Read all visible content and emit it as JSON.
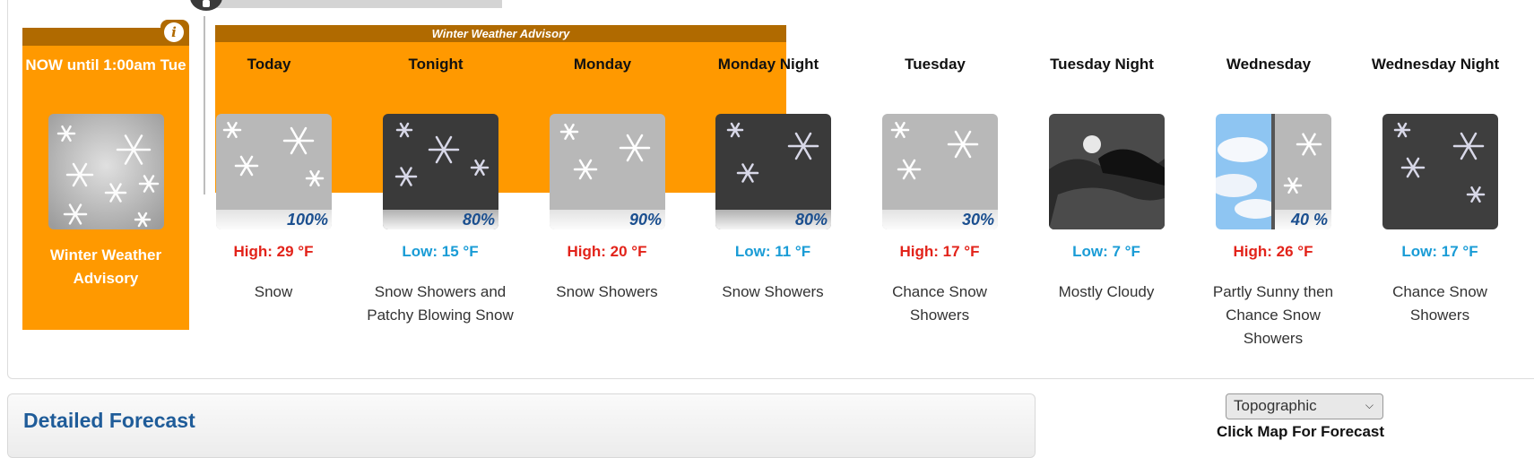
{
  "advisory": {
    "banner": "Winter Weather Advisory"
  },
  "now": {
    "title": "NOW until 1:00am Tue",
    "label": "Winter Weather Advisory",
    "icon": "snow-icon",
    "info_icon": "info-icon"
  },
  "periods": [
    {
      "name": "Today",
      "temp": "High: 29 °F",
      "kind": "high",
      "desc": "Snow",
      "pop": "100%",
      "icon": "snow"
    },
    {
      "name": "Tonight",
      "temp": "Low: 15 °F",
      "kind": "low",
      "desc": "Snow Showers and Patchy Blowing Snow",
      "pop": "80%",
      "icon": "snow-night"
    },
    {
      "name": "Monday",
      "temp": "High: 20 °F",
      "kind": "high",
      "desc": "Snow Showers",
      "pop": "90%",
      "icon": "snow"
    },
    {
      "name": "Monday Night",
      "temp": "Low: 11 °F",
      "kind": "low",
      "desc": "Snow Showers",
      "pop": "80%",
      "icon": "snow-night"
    },
    {
      "name": "Tuesday",
      "temp": "High: 17 °F",
      "kind": "high",
      "desc": "Chance Snow Showers",
      "pop": "30%",
      "icon": "snow"
    },
    {
      "name": "Tuesday Night",
      "temp": "Low: 7 °F",
      "kind": "low",
      "desc": "Mostly Cloudy",
      "pop": "",
      "icon": "cloudy-night"
    },
    {
      "name": "Wednesday",
      "temp": "High: 26 °F",
      "kind": "high",
      "desc": "Partly Sunny then Chance Snow Showers",
      "pop": "40 %",
      "icon": "sun-snow"
    },
    {
      "name": "Wednesday Night",
      "temp": "Low: 17 °F",
      "kind": "low",
      "desc": "Chance Snow Showers",
      "pop": "",
      "icon": "snow-night"
    }
  ],
  "detailed": {
    "title": "Detailed Forecast"
  },
  "map": {
    "select": "Topographic",
    "click": "Click Map For Forecast"
  },
  "colors": {
    "advisory": "#ff9900",
    "advisory_dark": "#b06a00",
    "high": "#e2231a",
    "low": "#1a9cd6",
    "link": "#1f5c99"
  }
}
